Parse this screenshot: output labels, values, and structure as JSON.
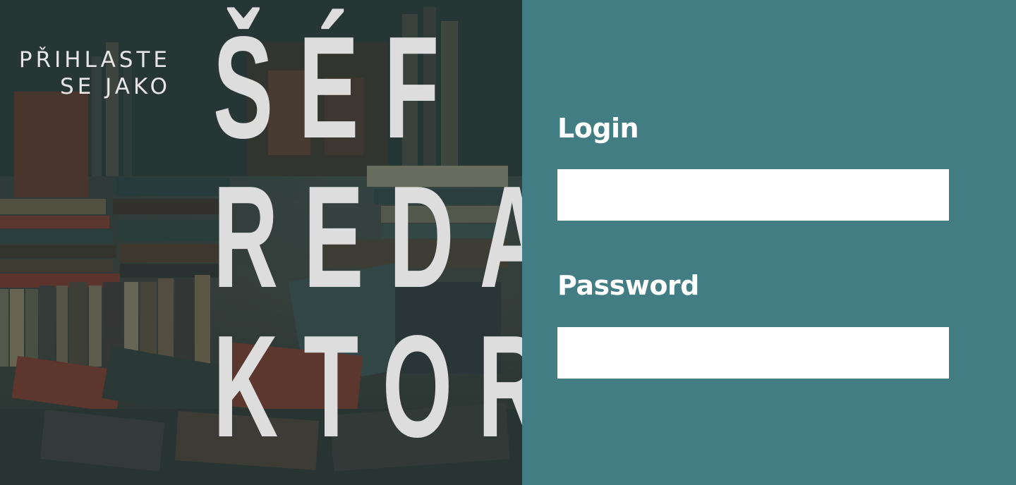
{
  "hero": {
    "kicker_line1": "PŘIHLASTE",
    "kicker_line2": "SE JAKO",
    "title_line1": "ŠÉF",
    "title_line2": "REDA",
    "title_line3": "KTOR"
  },
  "form": {
    "login_label": "Login",
    "login_value": "",
    "password_label": "Password",
    "password_value": ""
  },
  "colors": {
    "panel_background": "#437d84",
    "title_text": "#dedddd",
    "input_background": "#ffffff"
  }
}
